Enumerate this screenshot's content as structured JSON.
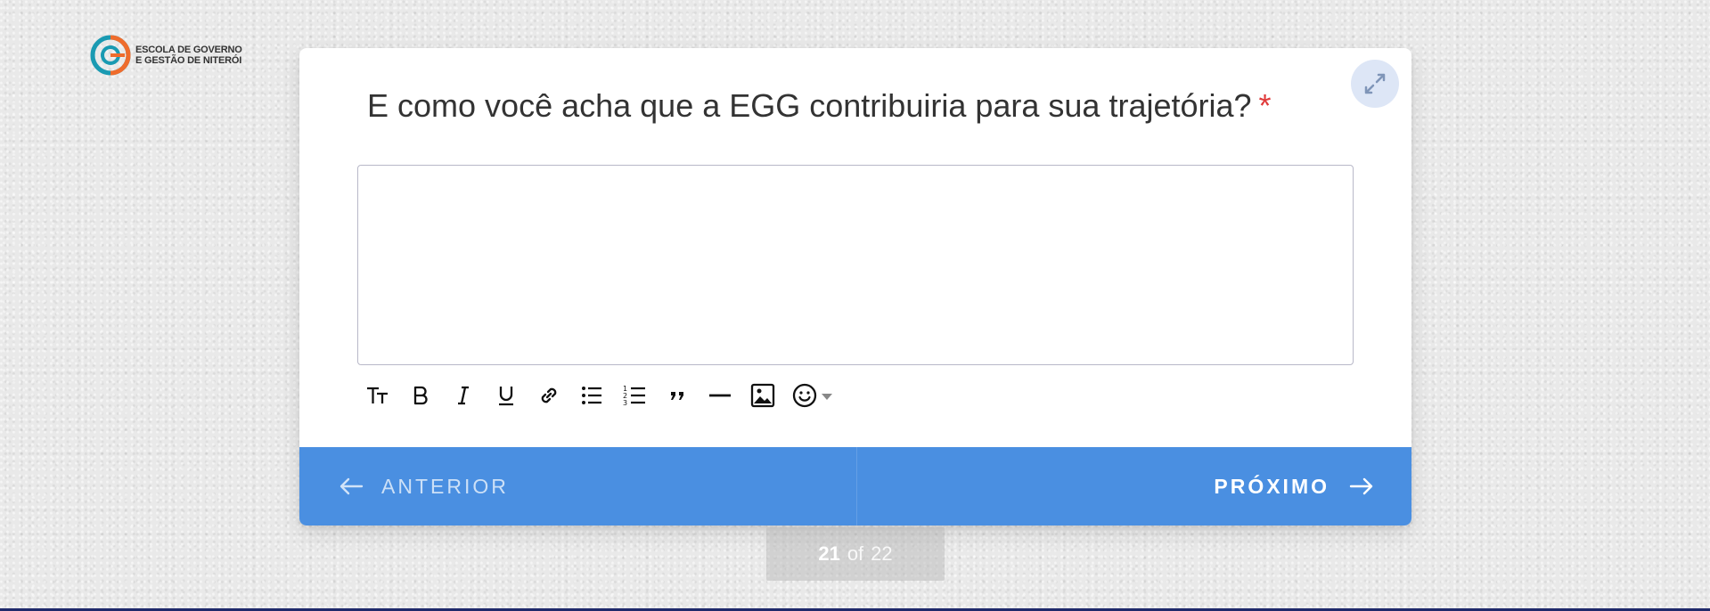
{
  "logo": {
    "line1": "ESCOLA DE GOVERNO",
    "line2": "E GESTÃO DE NITERÓI",
    "colors": {
      "teal": "#1a9ab2",
      "orange": "#ef6c2c"
    }
  },
  "question": {
    "text": "E como você acha que a EGG contribuiria para sua trajetória?",
    "required_mark": "*"
  },
  "answer": {
    "value": "",
    "placeholder": ""
  },
  "toolbar": {
    "tools": [
      "text-size-icon",
      "bold-icon",
      "italic-icon",
      "underline-icon",
      "link-icon",
      "bullet-list-icon",
      "numbered-list-icon",
      "quote-icon",
      "divider-icon",
      "image-icon",
      "emoji-icon"
    ]
  },
  "navigation": {
    "prev_label": "ANTERIOR",
    "next_label": "PRÓXIMO",
    "accent_color": "#4a8fe1"
  },
  "pager": {
    "current": "21",
    "of_label": "of",
    "total": "22"
  }
}
